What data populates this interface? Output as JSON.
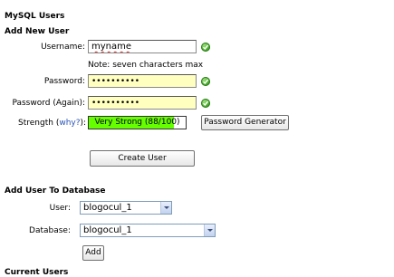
{
  "page": {
    "title": "MySQL Users",
    "add_user_heading": "Add New User",
    "add_db_heading": "Add User To Database",
    "current_users_heading": "Current Users"
  },
  "add_user": {
    "username_label": "Username:",
    "username_value": "myname",
    "username_note": "Note: seven characters max",
    "password_label": "Password:",
    "password_value": "••••••••••",
    "password_again_label": "Password (Again):",
    "password_again_value": "••••••••••",
    "strength_label": "Strength",
    "why_open": "(",
    "why_link": "why?",
    "why_close": "):",
    "strength_text": "Very Strong (88/100)",
    "strength_percent": 88,
    "password_generator_button": "Password Generator",
    "create_user_button": "Create User"
  },
  "add_to_db": {
    "user_label": "User:",
    "user_value": "blogocul_1",
    "database_label": "Database:",
    "database_value": "blogocul_1",
    "add_button": "Add"
  },
  "colors": {
    "strength_fill": "#66ff00",
    "password_field_bg": "#ffffc0",
    "valid_check": "#4fb02f",
    "link": "#2a55b5"
  },
  "icons": [
    "check-valid-icon",
    "dropdown-arrow-icon"
  ]
}
